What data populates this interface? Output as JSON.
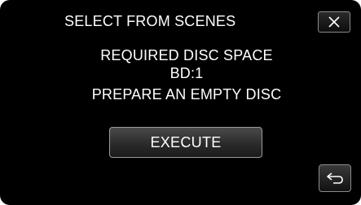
{
  "screen": {
    "title": "SELECT FROM SCENES",
    "message_line1": "REQUIRED DISC SPACE",
    "message_line2": "BD:1",
    "message_line3": "PREPARE AN EMPTY DISC"
  },
  "buttons": {
    "execute_label": "EXECUTE",
    "close_icon": "close-icon",
    "back_icon": "return-icon"
  },
  "colors": {
    "background": "#000000",
    "text": "#ffffff",
    "button_border": "#9a9a9a"
  }
}
